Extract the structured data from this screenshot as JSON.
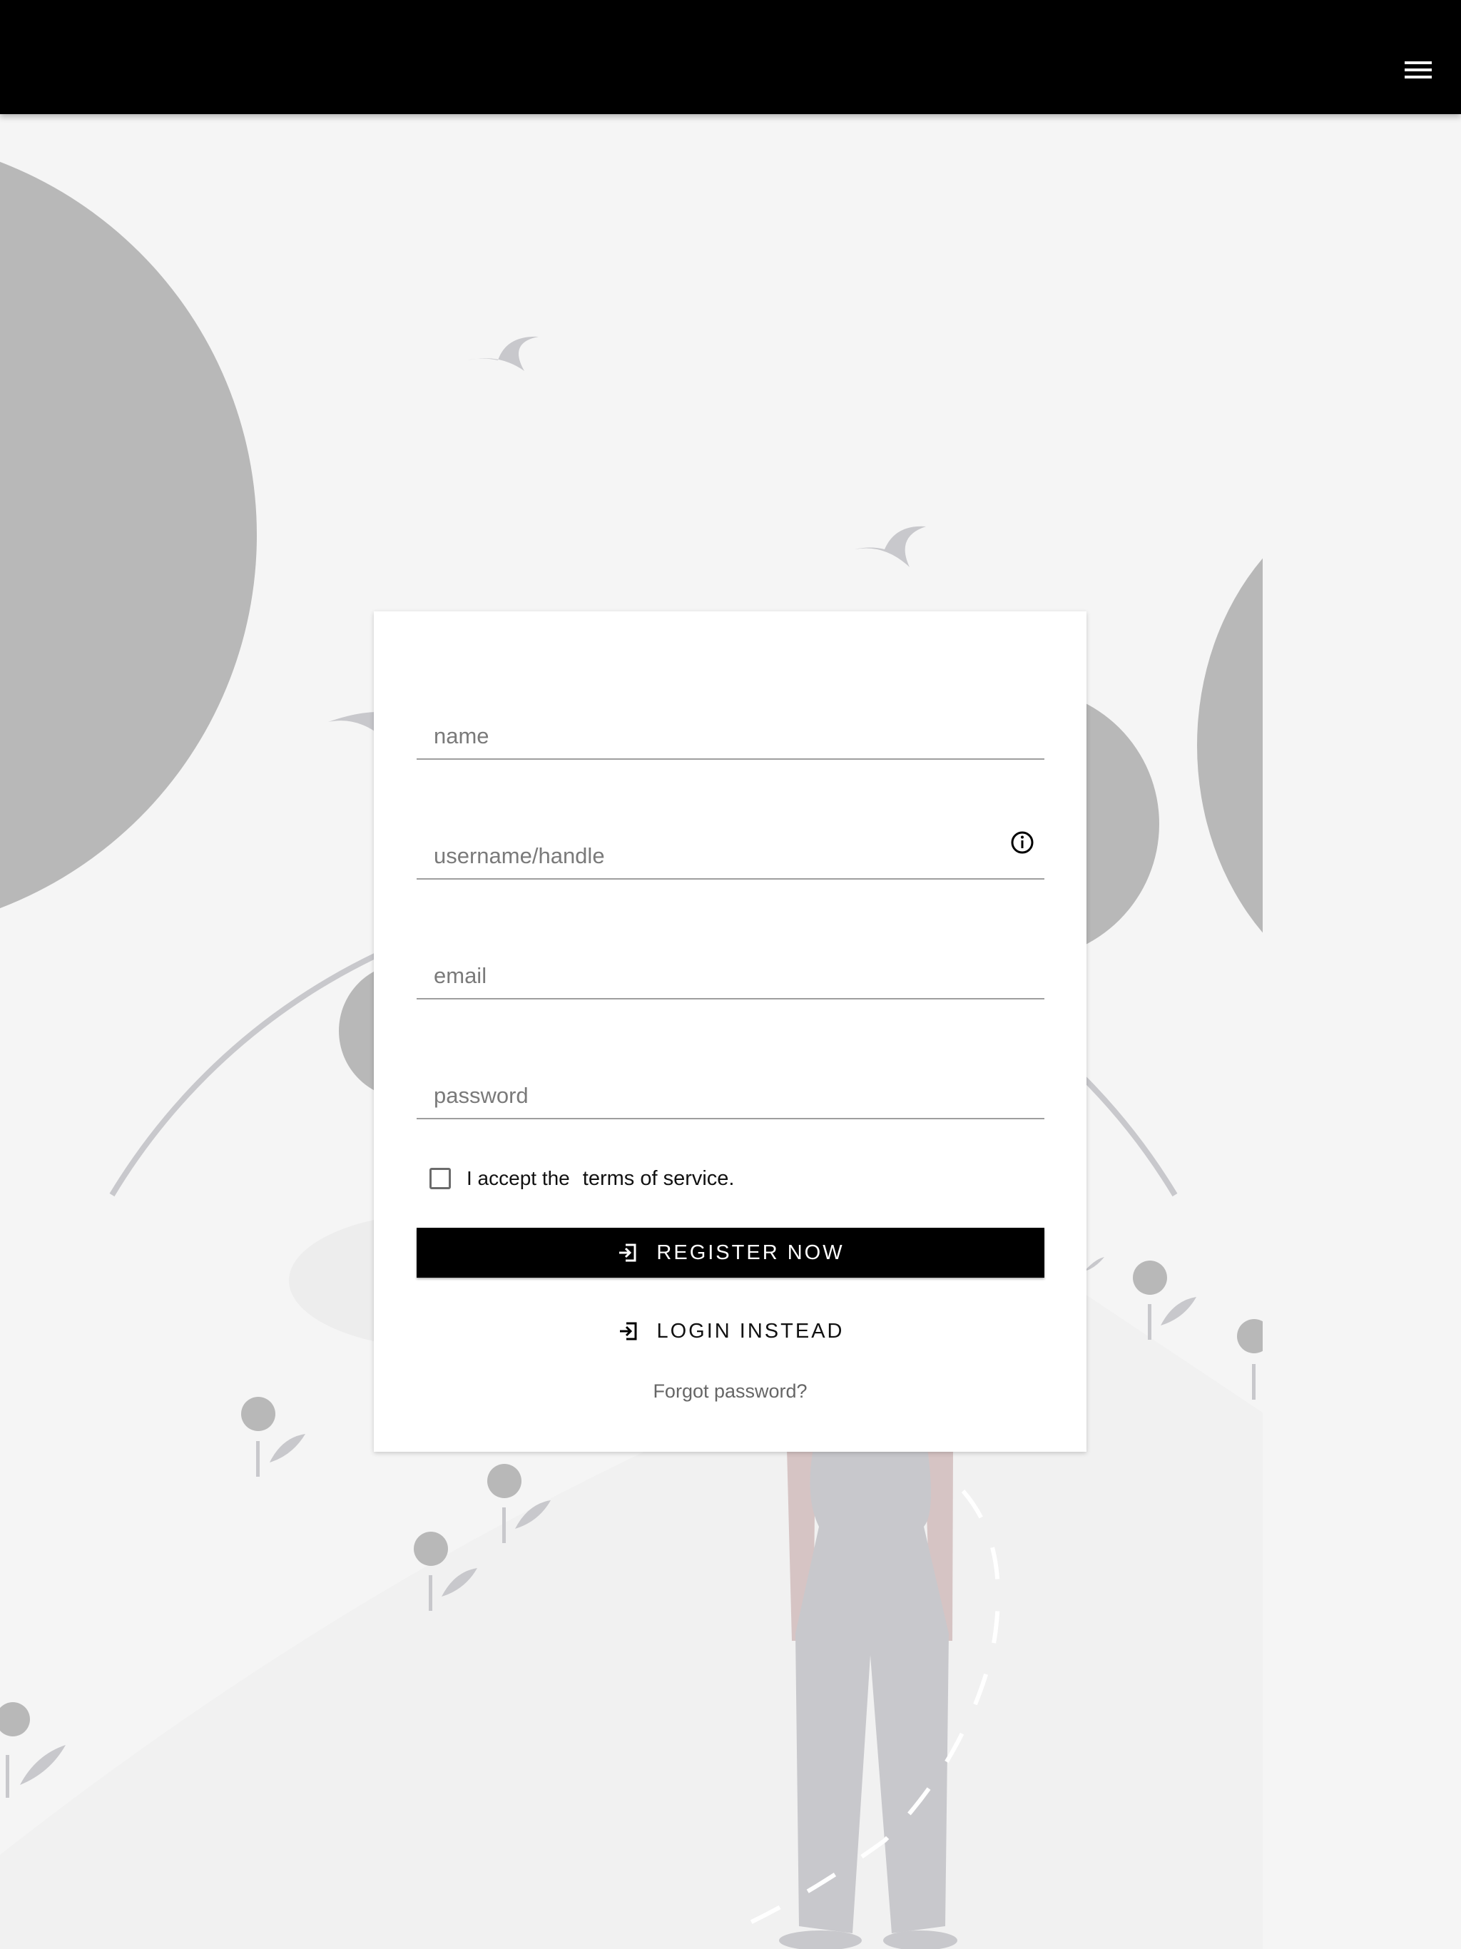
{
  "appbar": {
    "menu_icon": "menu-icon"
  },
  "form": {
    "fields": {
      "name": {
        "placeholder": "name",
        "value": ""
      },
      "username": {
        "placeholder": "username/handle",
        "value": "",
        "icon": "info-icon"
      },
      "email": {
        "placeholder": "email",
        "value": ""
      },
      "password": {
        "placeholder": "password",
        "value": ""
      }
    },
    "terms": {
      "prefix": "I accept the",
      "link": "terms of service.",
      "checked": false
    },
    "register_label": "REGISTER NOW",
    "login_label": "LOGIN INSTEAD",
    "forgot_label": "Forgot password?"
  },
  "colors": {
    "appbar": "#000000",
    "primary_button": "#000000",
    "background": "#f5f5f5",
    "illustration_gray": "#b8b8b8",
    "illustration_lavender": "#c8c8cc",
    "skin": "#d6c4c4"
  }
}
